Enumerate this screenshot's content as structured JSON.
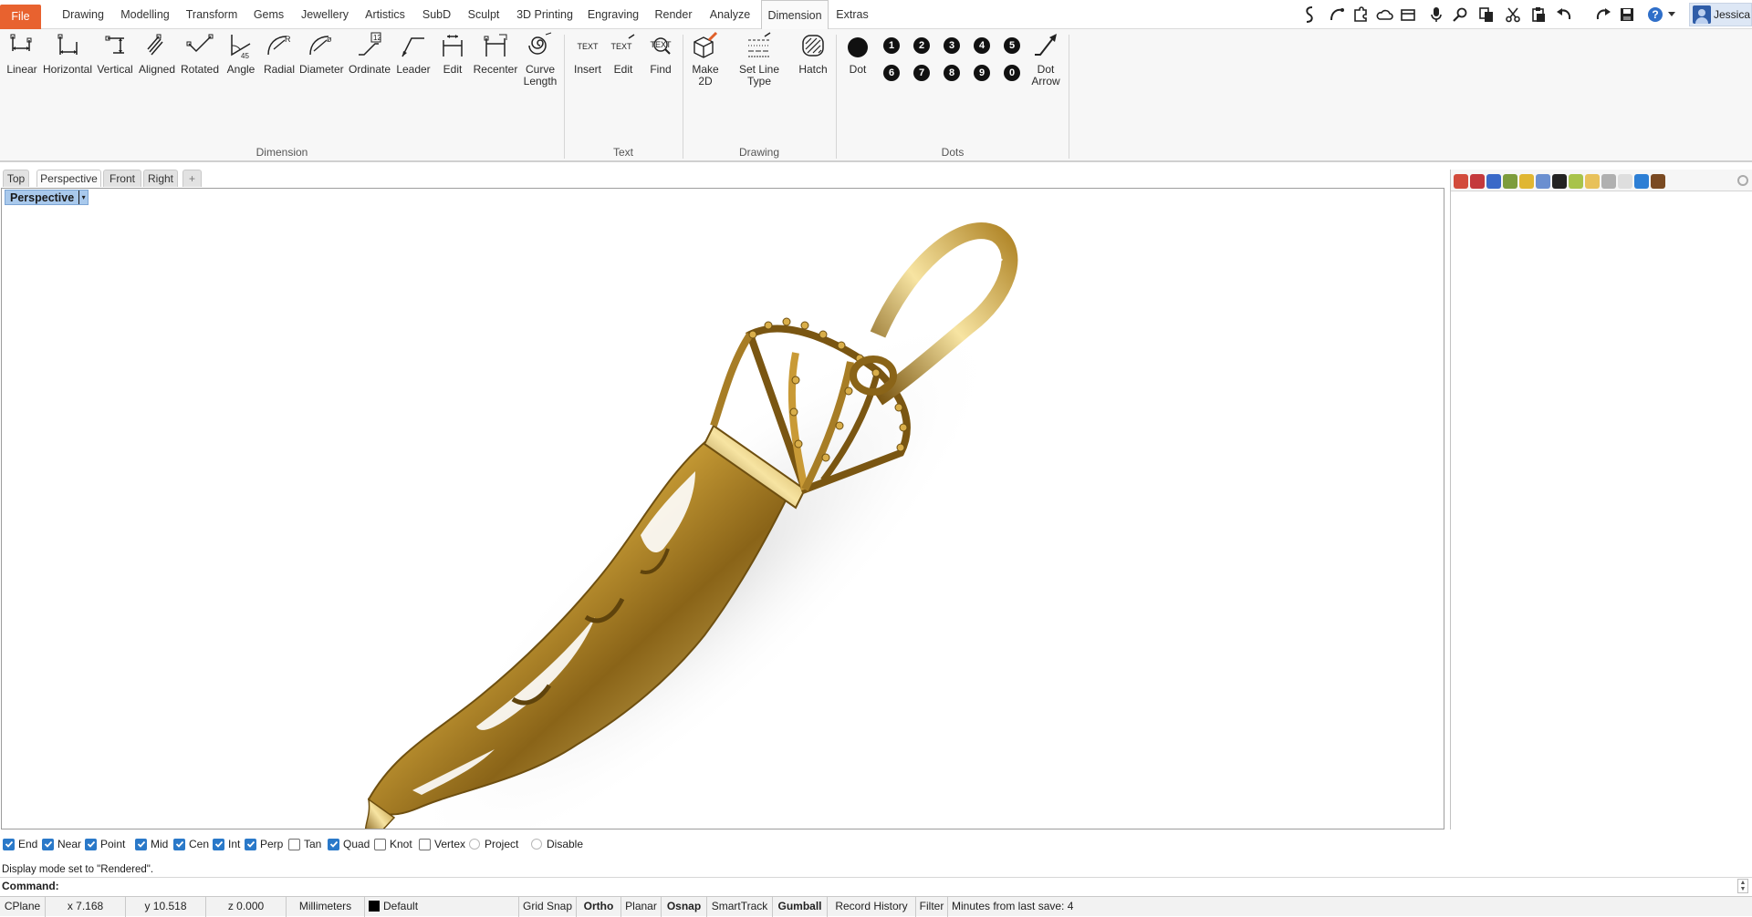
{
  "menubar": {
    "items": [
      "File",
      "Drawing",
      "Modelling",
      "Transform",
      "Gems",
      "Jewellery",
      "Artistics",
      "SubD",
      "Sculpt",
      "3D Printing",
      "Engraving",
      "Render",
      "Analyze",
      "Dimension",
      "Extras"
    ],
    "active": "Dimension",
    "user": "Jessica"
  },
  "qat_icons": [
    "snake-icon",
    "curve-icon",
    "puzzle-icon",
    "cloud-icon",
    "film-icon",
    "microphone-icon",
    "zoom-icon",
    "copy-icon",
    "cut-icon",
    "paste-icon",
    "undo-icon",
    "redo-icon",
    "save-icon",
    "help-icon"
  ],
  "ribbon": {
    "dimension": {
      "label": "Dimension",
      "buttons": [
        "Linear",
        "Horizontal",
        "Vertical",
        "Aligned",
        "Rotated",
        "Angle",
        "Radial",
        "Diameter",
        "Ordinate",
        "Leader",
        "Edit",
        "Recenter",
        "Curve Length"
      ]
    },
    "text": {
      "label": "Text",
      "buttons": [
        "Insert",
        "Edit",
        "Find"
      ],
      "icon_text": "TEXT"
    },
    "drawing": {
      "label": "Drawing",
      "buttons": [
        "Make 2D",
        "Set Line Type",
        "Hatch"
      ]
    },
    "dots": {
      "label": "Dots",
      "dot_label": "Dot",
      "dot_arrow_label": "Dot Arrow",
      "numbers": [
        "1",
        "2",
        "3",
        "4",
        "5",
        "6",
        "7",
        "8",
        "9",
        "0"
      ]
    }
  },
  "viewport_tabs": [
    "Top",
    "Perspective",
    "Front",
    "Right"
  ],
  "viewport_tab_add": "+",
  "viewport": {
    "label": "Perspective",
    "arrow": "▾"
  },
  "right_panel": {
    "icon_colors": [
      "#d24b3c",
      "#c4393c",
      "#3a69c8",
      "#7c9c3b",
      "#e0b632",
      "#6a8fd0",
      "#222222",
      "#a8c34a",
      "#e8c15a",
      "#b0b0b0",
      "#dedede",
      "#2d7fd5",
      "#7a4a22"
    ]
  },
  "osnaps": [
    {
      "label": "End",
      "checked": true,
      "type": "check"
    },
    {
      "label": "Near",
      "checked": true,
      "type": "check"
    },
    {
      "label": "Point",
      "checked": true,
      "type": "check"
    },
    {
      "label": "Mid",
      "checked": true,
      "type": "check"
    },
    {
      "label": "Cen",
      "checked": true,
      "type": "check"
    },
    {
      "label": "Int",
      "checked": true,
      "type": "check"
    },
    {
      "label": "Perp",
      "checked": true,
      "type": "check"
    },
    {
      "label": "Tan",
      "checked": false,
      "type": "check"
    },
    {
      "label": "Quad",
      "checked": true,
      "type": "check"
    },
    {
      "label": "Knot",
      "checked": false,
      "type": "check"
    },
    {
      "label": "Vertex",
      "checked": false,
      "type": "check"
    },
    {
      "label": "Project",
      "checked": false,
      "type": "radio"
    },
    {
      "label": "Disable",
      "checked": false,
      "type": "radio"
    }
  ],
  "command": {
    "history": "Display mode set to \"Rendered\".",
    "prompt": "Command:"
  },
  "statusbar": {
    "cplane": "CPlane",
    "x": "x 7.168",
    "y": "y 10.518",
    "z": "z 0.000",
    "units": "Millimeters",
    "layer": "Default",
    "grid_snap": "Grid Snap",
    "ortho": "Ortho",
    "planar": "Planar",
    "osnap": "Osnap",
    "smarttrack": "SmartTrack",
    "gumball": "Gumball",
    "record_history": "Record History",
    "filter": "Filter",
    "save_info": "Minutes from last save: 4"
  }
}
